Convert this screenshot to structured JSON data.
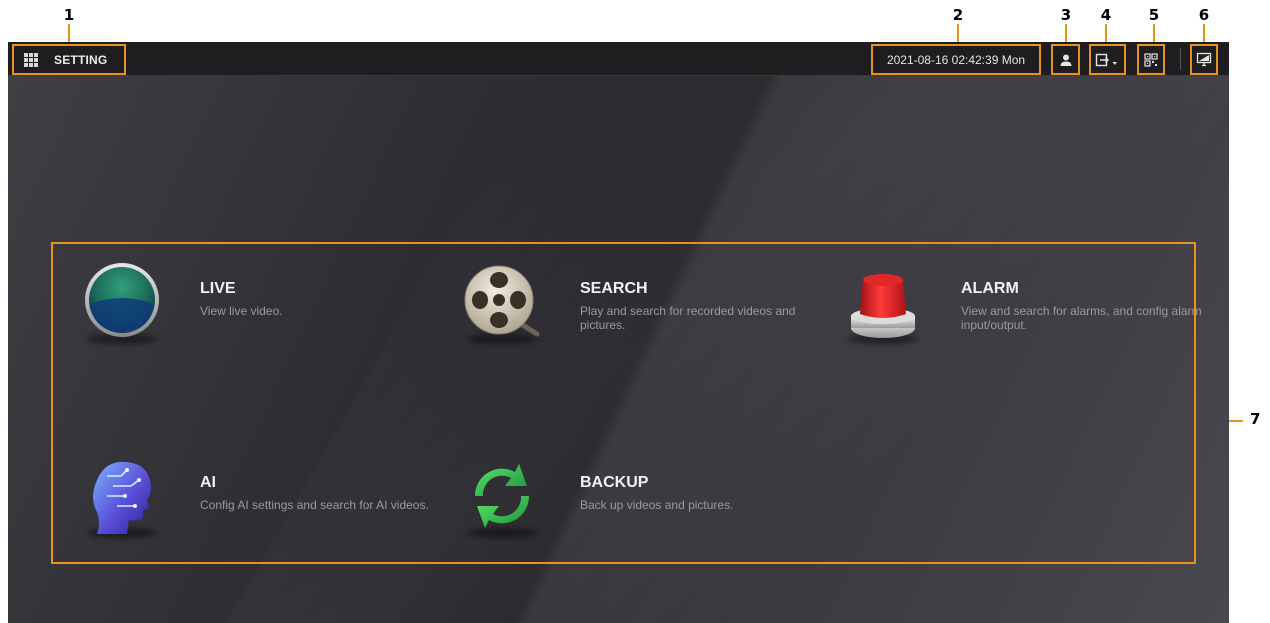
{
  "callouts": [
    "1",
    "2",
    "3",
    "4",
    "5",
    "6",
    "7"
  ],
  "topbar": {
    "menu_label": "SETTING",
    "datetime": "2021-08-16 02:42:39 Mon"
  },
  "tiles": [
    {
      "title": "LIVE",
      "desc": "View live video.",
      "icon": "live-icon"
    },
    {
      "title": "SEARCH",
      "desc": "Play and search for recorded videos and pictures.",
      "icon": "film-reel-icon"
    },
    {
      "title": "ALARM",
      "desc": "View and search for alarms, and config alarm input/output.",
      "icon": "alarm-light-icon"
    },
    {
      "title": "AI",
      "desc": "Config AI settings and search for AI videos.",
      "icon": "ai-head-icon"
    },
    {
      "title": "BACKUP",
      "desc": "Back up videos and pictures.",
      "icon": "backup-icon"
    }
  ],
  "colors": {
    "accent": "#e8921f",
    "topbar": "#1e1e21",
    "background": "#2f2f34"
  }
}
